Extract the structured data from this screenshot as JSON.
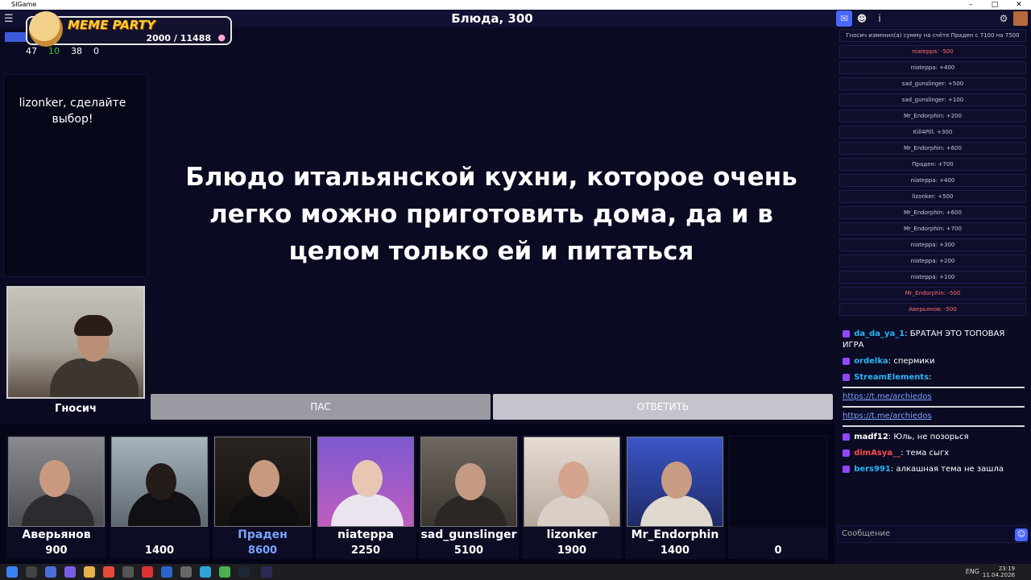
{
  "window": {
    "title": "SIGame"
  },
  "round": {
    "title": "Блюда, 300"
  },
  "overlay": {
    "brand": "MEME PARTY",
    "score": "2000 / 11488",
    "stats": [
      "47",
      "10",
      "38",
      "0"
    ]
  },
  "status": {
    "message": "lizonker, сделайте выбор!"
  },
  "question": {
    "text": "Блюдо итальянской кухни, которое очень легко можно приготовить дома, да и в целом только ей и питаться"
  },
  "buttons": {
    "pass": "ПАС",
    "answer": "ОТВЕТИТЬ"
  },
  "host": {
    "name": "Гносич"
  },
  "players": [
    {
      "name": "Аверьянов",
      "score": "900"
    },
    {
      "name": "",
      "score": "1400"
    },
    {
      "name": "Праден",
      "score": "8600"
    },
    {
      "name": "niateppa",
      "score": "2250"
    },
    {
      "name": "sad_gunslinger",
      "score": "5100"
    },
    {
      "name": "lizonker",
      "score": "1900"
    },
    {
      "name": "Mr_Endorphin",
      "score": "1400"
    },
    {
      "name": "",
      "score": "0"
    }
  ],
  "log": [
    "Гносич изменил(а) сумму на счёте Праден с 7100 на 7500",
    "niateppa: -500",
    "niateppa: +400",
    "sad_gunslinger: +500",
    "sad_gunslinger: +100",
    "Mr_Endorphin: +200",
    "Kill4Pill: +300",
    "Mr_Endorphin: +600",
    "Праден: +700",
    "niateppa: +400",
    "lizonker: +500",
    "Mr_Endorphin: +600",
    "Mr_Endorphin: +700",
    "niateppa: +300",
    "niateppa: +200",
    "niateppa: +100",
    "Mr_Endorphin: -500",
    "Аверьянов: -500"
  ],
  "chat": [
    {
      "user": "da_da_ya_1",
      "color": "#29b6f6",
      "text": "БРАТАН ЭТО ТОПОВАЯ ИГРА"
    },
    {
      "user": "ordelka",
      "color": "#29b6f6",
      "text": "спермики"
    },
    {
      "user": "StreamElements",
      "color": "#29b6f6",
      "text": ""
    },
    {
      "user": "madf12",
      "color": "#ffffff",
      "text": "Юль, не позорься"
    },
    {
      "user": "dimAsya__",
      "color": "#ff4d4d",
      "text": "тема сыгх"
    },
    {
      "user": "bers991",
      "color": "#29b6f6",
      "text": "алкашная тема не зашла"
    }
  ],
  "chat_links": [
    "https://t.me/archiedos",
    "https://t.me/archiedos"
  ],
  "input": {
    "placeholder": "Сообщение"
  },
  "taskbar": {
    "lang": "ENG",
    "time": "23:19",
    "date": "11.04.2026"
  }
}
